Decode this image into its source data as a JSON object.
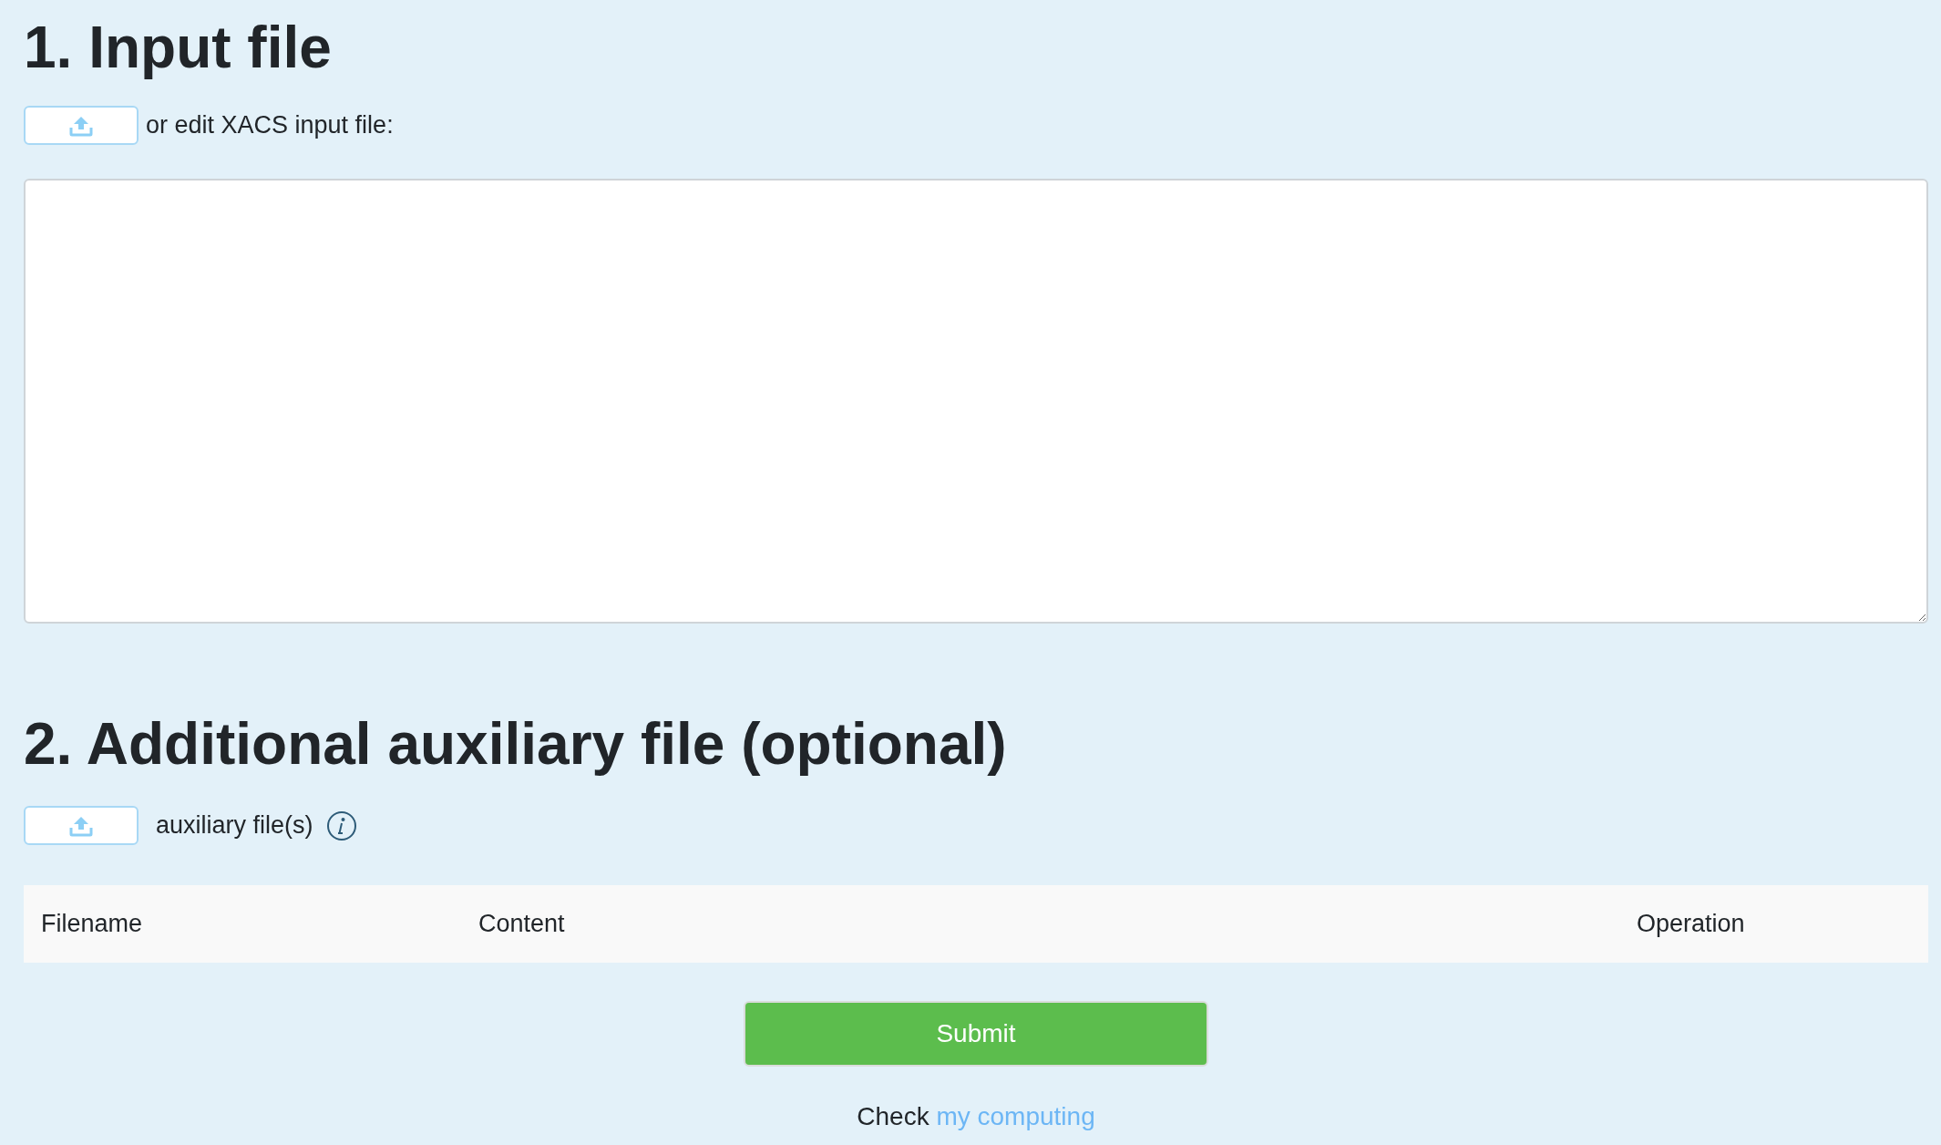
{
  "section_1": {
    "heading": "1. Input file",
    "upload_label": "or edit XACS input file:"
  },
  "section_2": {
    "heading": "2. Additional auxiliary file (optional)",
    "upload_label": "auxiliary file(s)",
    "table": {
      "columns": [
        "Filename",
        "Content",
        "Operation"
      ]
    }
  },
  "submit": "Submit",
  "footer": {
    "text": "Check",
    "link": "my computing"
  }
}
